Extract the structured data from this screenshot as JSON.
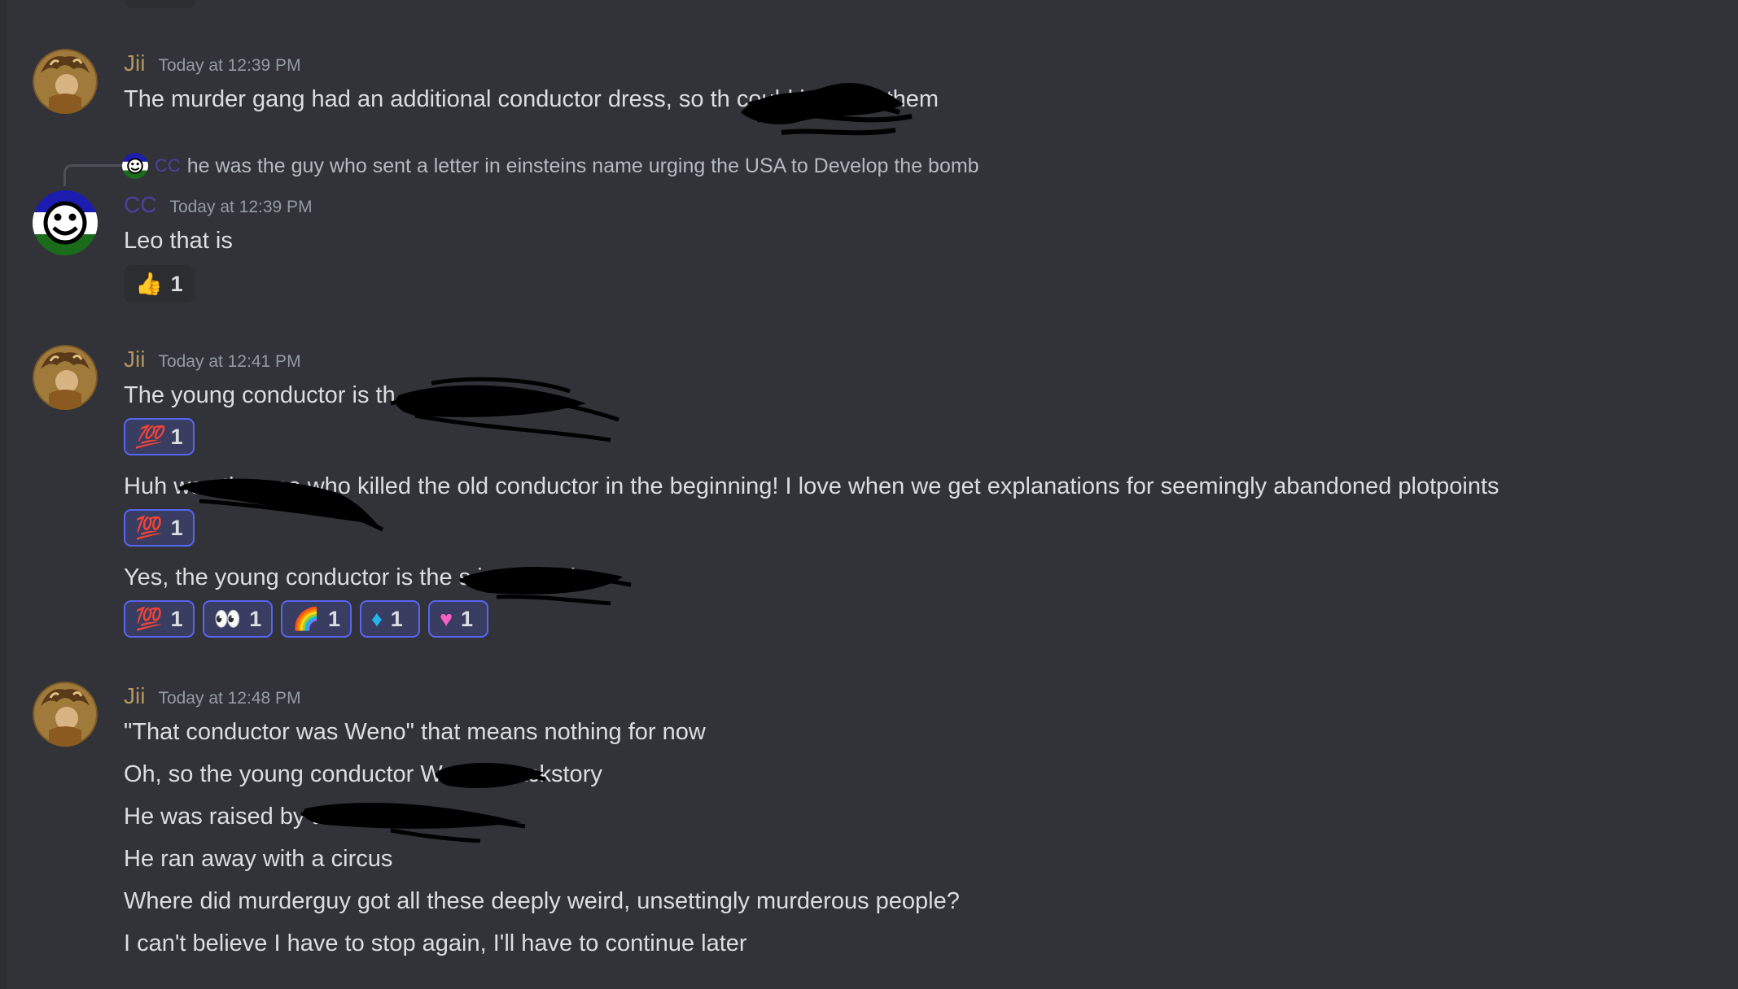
{
  "messages": [
    {
      "author": "Jii",
      "timestamp": "Today at 12:39 PM",
      "lines": [
        "The murder gang had an additional conductor dress, so th            could be from them"
      ]
    },
    {
      "reply": {
        "author": "CC",
        "text": "he was the guy who sent a letter in einsteins name urging the USA to Develop the bomb"
      },
      "author": "CC",
      "timestamp": "Today at 12:39 PM",
      "lines": [
        "Leo that is"
      ],
      "reactions": [
        {
          "icon": "thumbs-up-icon",
          "count": "1"
        }
      ]
    },
    {
      "author": "Jii",
      "timestamp": "Today at 12:41 PM",
      "lines": [
        "The young conductor is th",
        "Huh                              was the one who killed the old conductor in the beginning! I love when we get explanations for seemingly abandoned plotpoints",
        "Yes, the young conductor is the                    s is so cool"
      ],
      "reactions_a": [
        {
          "icon": "hundred-points-icon",
          "count": "1"
        }
      ],
      "reactions_b": [
        {
          "icon": "hundred-points-icon",
          "count": "1"
        }
      ],
      "reactions_c": [
        {
          "icon": "hundred-points-icon",
          "count": "1"
        },
        {
          "icon": "eyes-icon",
          "count": "1"
        },
        {
          "icon": "rainbow-icon",
          "count": "1"
        },
        {
          "icon": "diamond-icon",
          "count": "1"
        },
        {
          "icon": "heart-icon",
          "count": "1"
        }
      ]
    },
    {
      "author": "Jii",
      "timestamp": "Today at 12:48 PM",
      "lines": [
        "\"That conductor was Weno\" that means nothing for now",
        "Oh, so the young conductor                 We get backstory",
        "He was raised by th",
        "He ran away with a circus",
        "Where did murderguy got all these deeply weird, unsettingly murderous people?",
        "I can't believe I have to stop again, I'll have to continue later"
      ]
    }
  ],
  "colors": {
    "background": "#313338",
    "jii_name": "#b4955f",
    "cc_name": "#4e3f9c",
    "reaction_active_border": "#5865f2"
  }
}
